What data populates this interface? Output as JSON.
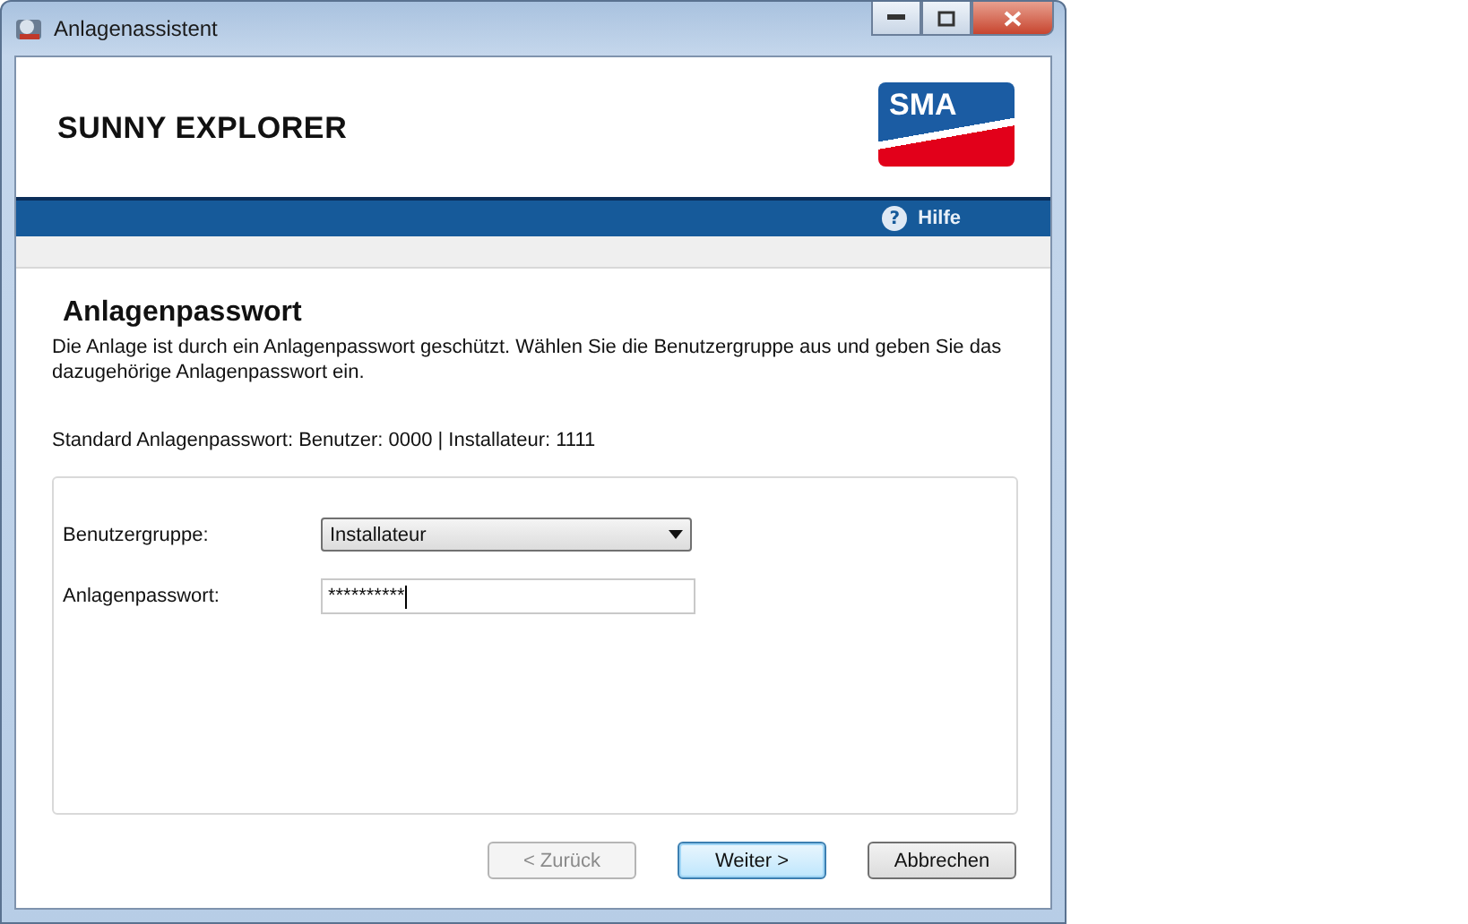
{
  "window": {
    "title": "Anlagenassistent"
  },
  "header": {
    "app_name": "SUNNY EXPLORER",
    "logo_text": "SMA"
  },
  "nav_bar": {
    "help_icon": "?",
    "help_label": "Hilfe"
  },
  "page": {
    "heading": "Anlagenpasswort",
    "description": "Die Anlage ist durch ein Anlagenpasswort geschützt. Wählen Sie die Benutzergruppe aus und geben Sie das dazugehörige Anlagenpasswort ein.",
    "default_info": "Standard Anlagenpasswort: Benutzer: 0000 | Installateur: 1111"
  },
  "form": {
    "fields": [
      {
        "kind": "dropdown",
        "label": "Benutzergruppe:",
        "value": "Installateur"
      },
      {
        "kind": "password",
        "label": "Anlagenpasswort:",
        "value": "**********"
      }
    ]
  },
  "buttons": [
    {
      "label": "< Zurück",
      "disabled": true,
      "default": false
    },
    {
      "label": "Weiter >",
      "disabled": false,
      "default": true
    },
    {
      "label": "Abbrechen",
      "disabled": false,
      "default": false
    }
  ]
}
